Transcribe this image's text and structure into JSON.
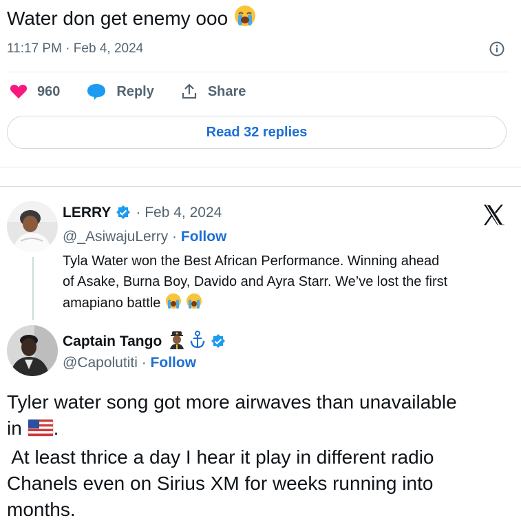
{
  "top_tweet": {
    "text": "Water don get enemy ooo",
    "timestamp": "11:17 PM · Feb 4, 2024",
    "likes": "960",
    "reply_label": "Reply",
    "share_label": "Share",
    "read_replies_label": "Read 32 replies"
  },
  "quoted": {
    "name": "LERRY",
    "date": "· Feb 4, 2024",
    "handle": "@_AsiwajuLerry ·",
    "follow_label": "Follow",
    "text_line1": "Tyla Water won the Best African Performance. Winning ahead",
    "text_line2": "of Asake, Burna Boy, Davido and Ayra Starr. We’ve lost the first",
    "text_line3": "amapiano battle"
  },
  "reply": {
    "name": "Captain Tango",
    "handle": "@Capolutiti ·",
    "follow_label": "Follow",
    "text_line1": "Tyler water song got more airwaves than unavailable",
    "text_line2_pre": "in",
    "text_line2_post": ".",
    "text_line3": " At least thrice a day I hear it play in different radio",
    "text_line4": "Chanels even on Sirius XM for weeks running into",
    "text_line5": "months."
  },
  "colors": {
    "accent": "#1d6fd4",
    "like": "#f91880",
    "reply_icon": "#1d9bf0",
    "verified": "#1d9bf0",
    "muted": "#536471"
  },
  "icons": [
    "crying-emoji",
    "info-icon",
    "heart-icon",
    "reply-bubble-icon",
    "share-icon",
    "verified-badge-icon",
    "x-logo-icon",
    "captain-emoji",
    "anchor-icon",
    "us-flag-emoji"
  ]
}
